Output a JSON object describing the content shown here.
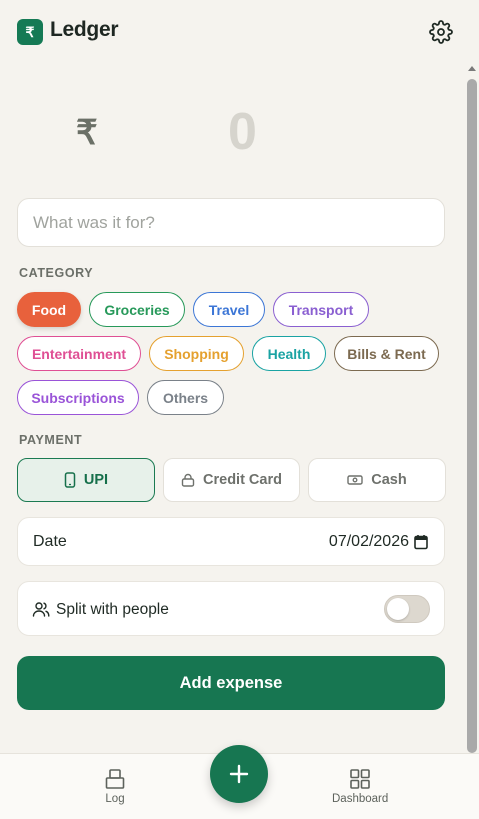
{
  "header": {
    "title": "Ledger",
    "logo_symbol": "₹"
  },
  "amount": {
    "currency_symbol": "₹",
    "value": "0"
  },
  "description": {
    "placeholder": "What was it for?",
    "value": ""
  },
  "category": {
    "label": "CATEGORY",
    "selected": "Food",
    "chips": [
      {
        "label": "Food",
        "color": "#e8613c"
      },
      {
        "label": "Groceries",
        "color": "#27995a"
      },
      {
        "label": "Travel",
        "color": "#3c76d6"
      },
      {
        "label": "Transport",
        "color": "#8a5fd1"
      },
      {
        "label": "Entertainment",
        "color": "#df4f94"
      },
      {
        "label": "Shopping",
        "color": "#e5a12f"
      },
      {
        "label": "Health",
        "color": "#1aa3a3"
      },
      {
        "label": "Bills & Rent",
        "color": "#7c6a50"
      },
      {
        "label": "Subscriptions",
        "color": "#9a54d8"
      },
      {
        "label": "Others",
        "color": "#7a8189"
      }
    ]
  },
  "payment": {
    "label": "PAYMENT",
    "selected": "UPI",
    "methods": [
      {
        "label": "UPI",
        "icon": "phone-icon"
      },
      {
        "label": "Credit Card",
        "icon": "lock-icon"
      },
      {
        "label": "Cash",
        "icon": "banknote-icon"
      }
    ]
  },
  "date": {
    "label": "Date",
    "value": "07/02/2026"
  },
  "split": {
    "label": "Split with people",
    "enabled": false
  },
  "submit_label": "Add expense",
  "nav": {
    "log_label": "Log",
    "dashboard_label": "Dashboard"
  },
  "colors": {
    "brand": "#177651",
    "background": "#f5f3ee"
  }
}
